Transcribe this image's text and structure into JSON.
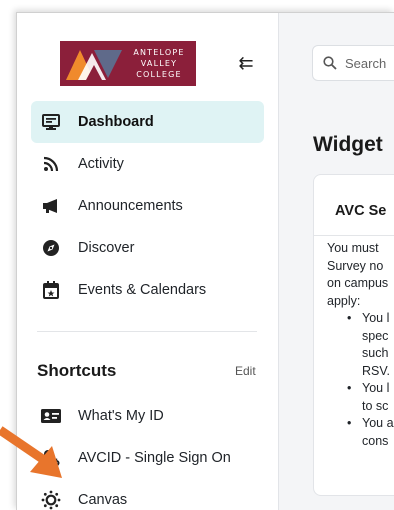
{
  "logo": {
    "line1": "ANTELOPE",
    "line2": "VALLEY",
    "line3": "COLLEGE",
    "bg_color": "#8b1f3a"
  },
  "sidebar": {
    "collapse_icon": "⇇",
    "nav": [
      {
        "label": "Dashboard",
        "icon": "monitor-icon"
      },
      {
        "label": "Activity",
        "icon": "rss-icon"
      },
      {
        "label": "Announcements",
        "icon": "megaphone-icon"
      },
      {
        "label": "Discover",
        "icon": "compass-icon"
      },
      {
        "label": "Events & Calendars",
        "icon": "calendar-icon"
      }
    ],
    "shortcuts": {
      "title": "Shortcuts",
      "edit": "Edit",
      "items": [
        {
          "label": "What's My ID",
          "icon": "id-card-icon"
        },
        {
          "label": "AVCID - Single Sign On",
          "icon": "user-gear-icon"
        },
        {
          "label": "Canvas",
          "icon": "canvas-icon"
        }
      ]
    }
  },
  "main": {
    "search_placeholder": "Search",
    "widget_title": "Widget",
    "card": {
      "title": "AVC Se",
      "lines": [
        "You must",
        "Survey no",
        "on campus",
        "apply:"
      ],
      "bullets": [
        [
          "You l",
          "spec",
          "such",
          "RSV."
        ],
        [
          "You l",
          "to sc"
        ],
        [
          "You a",
          "cons"
        ]
      ]
    }
  },
  "colors": {
    "accent": "#dff3f4",
    "arrow": "#e8752c"
  }
}
